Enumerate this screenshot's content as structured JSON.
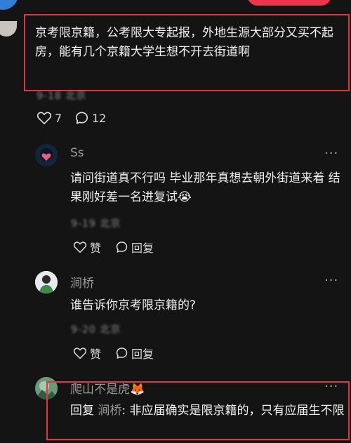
{
  "main_comment": {
    "text": "京考限京籍，公考限大专起报，外地生源大部分又买不起房，能有几个京籍大学生想不开去街道啊",
    "meta": "9-18 北京",
    "likes": "7",
    "comments": "12"
  },
  "replies": [
    {
      "username": "Ss",
      "more": "···",
      "text": "请问街道真不行吗 毕业那年真想去朝外街道来着 结果刚好差一名进复试",
      "emoji": "😭",
      "meta": "9-19 北京",
      "like_label": "赞",
      "reply_label": "回复"
    },
    {
      "username": "涧桥",
      "more": "···",
      "text": "谁告诉你京考限京籍的?",
      "meta": "9-20 北京",
      "like_label": "赞",
      "reply_label": "回复"
    },
    {
      "username": "爬山不是虎",
      "username_emoji": "🦊",
      "more": "···",
      "reply_prefix": "回复",
      "reply_to": "涧桥",
      "text": ": 非应届确实是限京籍的，只有应届生不限"
    }
  ],
  "colors": {
    "background": "#141414",
    "highlight_box": "#e8323f",
    "top_pill": "#f2344b",
    "top_avatar": "#2f7fd6"
  }
}
